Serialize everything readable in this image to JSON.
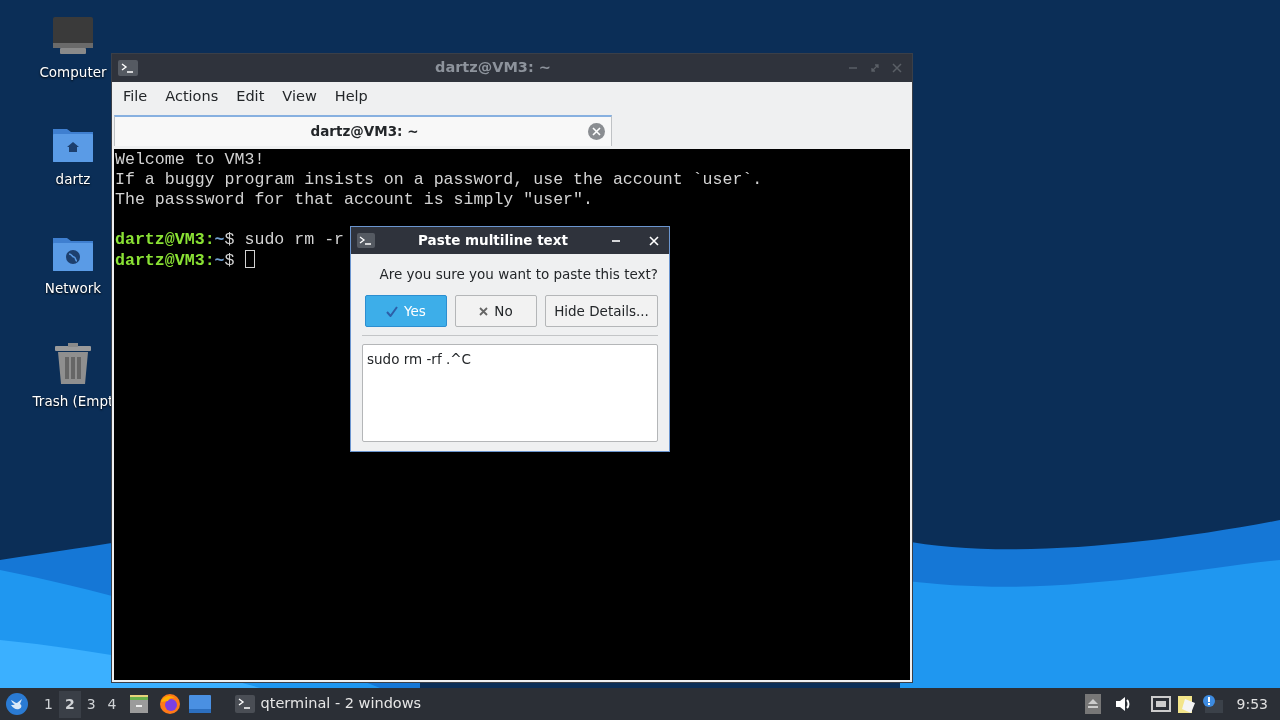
{
  "desktop_icons": [
    {
      "label": "Computer",
      "kind": "computer"
    },
    {
      "label": "dartz",
      "kind": "home"
    },
    {
      "label": "Network",
      "kind": "network"
    },
    {
      "label": "Trash (Empt",
      "kind": "trash"
    }
  ],
  "terminal": {
    "title": "dartz@VM3: ~",
    "menu": [
      "File",
      "Actions",
      "Edit",
      "View",
      "Help"
    ],
    "tabs": [
      {
        "label": "dartz@VM3: ~",
        "selected": true
      }
    ],
    "lines": [
      {
        "kind": "output",
        "text": "Welcome to VM3!"
      },
      {
        "kind": "output",
        "text": "If a buggy program insists on a password, use the account `user`."
      },
      {
        "kind": "output",
        "text": "The passsword for that account is simply \"user\"."
      },
      {
        "kind": "blank"
      },
      {
        "kind": "prompt",
        "user": "dartz@VM3",
        "sep": ":",
        "path": "~",
        "symbol": "$",
        "command": "sudo rm -r",
        "cursor": false
      },
      {
        "kind": "prompt",
        "user": "dartz@VM3",
        "sep": ":",
        "path": "~",
        "symbol": "$",
        "cursor": true
      }
    ]
  },
  "dialog": {
    "title": "Paste multiline text",
    "message": "Are you sure you want to paste this text?",
    "buttons": [
      {
        "label": "Yes",
        "kind": "check",
        "default": true
      },
      {
        "label": "No",
        "kind": "cross",
        "default": false
      },
      {
        "label": "Hide Details...",
        "kind": "plain",
        "default": false
      }
    ],
    "details": "sudo rm -rf .^C"
  },
  "taskbar": {
    "workspaces": [
      {
        "label": "1",
        "selected": false
      },
      {
        "label": "2",
        "selected": true
      },
      {
        "label": "3",
        "selected": false
      },
      {
        "label": "4",
        "selected": false
      }
    ],
    "task": "qterminal - 2 windows",
    "clock": "9:53"
  }
}
